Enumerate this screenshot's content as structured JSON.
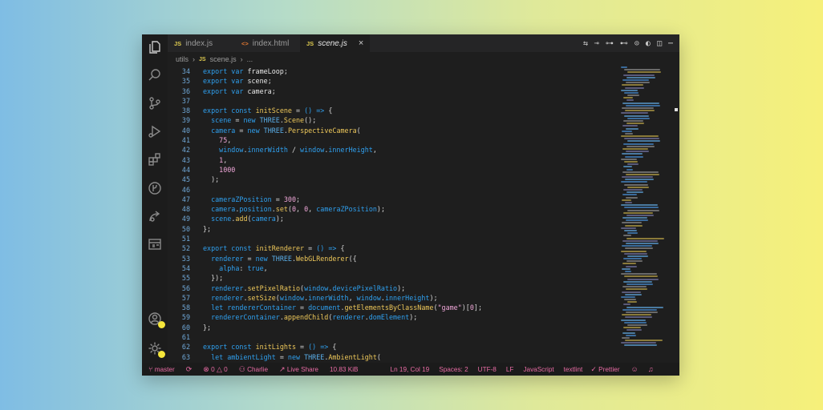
{
  "tabs": [
    {
      "label": "index.js",
      "icon": "JS"
    },
    {
      "label": "index.html",
      "icon": "<>"
    },
    {
      "label": "scene.js",
      "icon": "JS"
    }
  ],
  "tab_close": "×",
  "breadcrumb": {
    "folder": "utils",
    "file": "scene.js",
    "more": "..."
  },
  "js_icon": "JS",
  "code": [
    {
      "n": "34",
      "t": [
        [
          "kw",
          "export "
        ],
        [
          "kw",
          "var "
        ],
        [
          "id",
          "frameLoop"
        ],
        [
          "pun",
          ";"
        ]
      ]
    },
    {
      "n": "35",
      "t": [
        [
          "kw",
          "export "
        ],
        [
          "kw",
          "var "
        ],
        [
          "id",
          "scene"
        ],
        [
          "pun",
          ";"
        ]
      ]
    },
    {
      "n": "36",
      "t": [
        [
          "kw",
          "export "
        ],
        [
          "kw",
          "var "
        ],
        [
          "id",
          "camera"
        ],
        [
          "pun",
          ";"
        ]
      ]
    },
    {
      "n": "37",
      "t": []
    },
    {
      "n": "38",
      "t": [
        [
          "kw",
          "export "
        ],
        [
          "kw",
          "const "
        ],
        [
          "fn",
          "initScene"
        ],
        [
          "pun",
          " = "
        ],
        [
          "kw",
          "() => "
        ],
        [
          "pun",
          "{"
        ]
      ]
    },
    {
      "n": "39",
      "t": [
        [
          "id",
          "  "
        ],
        [
          "prm",
          "scene"
        ],
        [
          "pun",
          " = "
        ],
        [
          "kw",
          "new "
        ],
        [
          "cl",
          "THREE"
        ],
        [
          "pun",
          "."
        ],
        [
          "fn",
          "Scene"
        ],
        [
          "pun",
          "();"
        ]
      ]
    },
    {
      "n": "40",
      "t": [
        [
          "id",
          "  "
        ],
        [
          "prm",
          "camera"
        ],
        [
          "pun",
          " = "
        ],
        [
          "kw",
          "new "
        ],
        [
          "cl",
          "THREE"
        ],
        [
          "pun",
          "."
        ],
        [
          "fn",
          "PerspectiveCamera"
        ],
        [
          "pun",
          "("
        ]
      ]
    },
    {
      "n": "41",
      "t": [
        [
          "id",
          "    "
        ],
        [
          "num",
          "75"
        ],
        [
          "pun",
          ","
        ]
      ]
    },
    {
      "n": "42",
      "t": [
        [
          "id",
          "    "
        ],
        [
          "prm",
          "window"
        ],
        [
          "pun",
          "."
        ],
        [
          "prm",
          "innerWidth"
        ],
        [
          "pun",
          " / "
        ],
        [
          "prm",
          "window"
        ],
        [
          "pun",
          "."
        ],
        [
          "prm",
          "innerHeight"
        ],
        [
          "pun",
          ","
        ]
      ]
    },
    {
      "n": "43",
      "t": [
        [
          "id",
          "    "
        ],
        [
          "num",
          "1"
        ],
        [
          "pun",
          ","
        ]
      ]
    },
    {
      "n": "44",
      "t": [
        [
          "id",
          "    "
        ],
        [
          "num",
          "1000"
        ]
      ]
    },
    {
      "n": "45",
      "t": [
        [
          "pun",
          "  );"
        ]
      ]
    },
    {
      "n": "46",
      "t": []
    },
    {
      "n": "47",
      "t": [
        [
          "id",
          "  "
        ],
        [
          "prm",
          "cameraZPosition"
        ],
        [
          "pun",
          " = "
        ],
        [
          "num",
          "300"
        ],
        [
          "pun",
          ";"
        ]
      ]
    },
    {
      "n": "48",
      "t": [
        [
          "id",
          "  "
        ],
        [
          "prm",
          "camera"
        ],
        [
          "pun",
          "."
        ],
        [
          "prm",
          "position"
        ],
        [
          "pun",
          "."
        ],
        [
          "fn",
          "set"
        ],
        [
          "pun",
          "("
        ],
        [
          "num",
          "0"
        ],
        [
          "pun",
          ", "
        ],
        [
          "num",
          "0"
        ],
        [
          "pun",
          ", "
        ],
        [
          "prm",
          "cameraZPosition"
        ],
        [
          "pun",
          ");"
        ]
      ]
    },
    {
      "n": "49",
      "t": [
        [
          "id",
          "  "
        ],
        [
          "prm",
          "scene"
        ],
        [
          "pun",
          "."
        ],
        [
          "fn",
          "add"
        ],
        [
          "pun",
          "("
        ],
        [
          "prm",
          "camera"
        ],
        [
          "pun",
          ");"
        ]
      ]
    },
    {
      "n": "50",
      "t": [
        [
          "pun",
          "};"
        ]
      ]
    },
    {
      "n": "51",
      "t": []
    },
    {
      "n": "52",
      "t": [
        [
          "kw",
          "export "
        ],
        [
          "kw",
          "const "
        ],
        [
          "fn",
          "initRenderer"
        ],
        [
          "pun",
          " = "
        ],
        [
          "kw",
          "() => "
        ],
        [
          "pun",
          "{"
        ]
      ]
    },
    {
      "n": "53",
      "t": [
        [
          "id",
          "  "
        ],
        [
          "prm",
          "renderer"
        ],
        [
          "pun",
          " = "
        ],
        [
          "kw",
          "new "
        ],
        [
          "cl",
          "THREE"
        ],
        [
          "pun",
          "."
        ],
        [
          "fn",
          "WebGLRenderer"
        ],
        [
          "pun",
          "({"
        ]
      ]
    },
    {
      "n": "54",
      "t": [
        [
          "id",
          "    "
        ],
        [
          "prm",
          "alpha"
        ],
        [
          "pun",
          ": "
        ],
        [
          "kw",
          "true"
        ],
        [
          "pun",
          ","
        ]
      ]
    },
    {
      "n": "55",
      "t": [
        [
          "pun",
          "  });"
        ]
      ]
    },
    {
      "n": "56",
      "t": [
        [
          "id",
          "  "
        ],
        [
          "prm",
          "renderer"
        ],
        [
          "pun",
          "."
        ],
        [
          "fn",
          "setPixelRatio"
        ],
        [
          "pun",
          "("
        ],
        [
          "prm",
          "window"
        ],
        [
          "pun",
          "."
        ],
        [
          "prm",
          "devicePixelRatio"
        ],
        [
          "pun",
          ");"
        ]
      ]
    },
    {
      "n": "57",
      "t": [
        [
          "id",
          "  "
        ],
        [
          "prm",
          "renderer"
        ],
        [
          "pun",
          "."
        ],
        [
          "fn",
          "setSize"
        ],
        [
          "pun",
          "("
        ],
        [
          "prm",
          "window"
        ],
        [
          "pun",
          "."
        ],
        [
          "prm",
          "innerWidth"
        ],
        [
          "pun",
          ", "
        ],
        [
          "prm",
          "window"
        ],
        [
          "pun",
          "."
        ],
        [
          "prm",
          "innerHeight"
        ],
        [
          "pun",
          ");"
        ]
      ]
    },
    {
      "n": "58",
      "t": [
        [
          "id",
          "  "
        ],
        [
          "kw",
          "let "
        ],
        [
          "prm",
          "rendererContainer"
        ],
        [
          "pun",
          " = "
        ],
        [
          "prm",
          "document"
        ],
        [
          "pun",
          "."
        ],
        [
          "fn",
          "getElementsByClassName"
        ],
        [
          "pun",
          "("
        ],
        [
          "str",
          "\"game\""
        ],
        [
          "pun",
          ")["
        ],
        [
          "num",
          "0"
        ],
        [
          "pun",
          "];"
        ]
      ]
    },
    {
      "n": "59",
      "t": [
        [
          "id",
          "  "
        ],
        [
          "prm",
          "rendererContainer"
        ],
        [
          "pun",
          "."
        ],
        [
          "fn",
          "appendChild"
        ],
        [
          "pun",
          "("
        ],
        [
          "prm",
          "renderer"
        ],
        [
          "pun",
          "."
        ],
        [
          "prm",
          "domElement"
        ],
        [
          "pun",
          ");"
        ]
      ]
    },
    {
      "n": "60",
      "t": [
        [
          "pun",
          "};"
        ]
      ]
    },
    {
      "n": "61",
      "t": []
    },
    {
      "n": "62",
      "t": [
        [
          "kw",
          "export "
        ],
        [
          "kw",
          "const "
        ],
        [
          "fn",
          "initLights"
        ],
        [
          "pun",
          " = "
        ],
        [
          "kw",
          "() => "
        ],
        [
          "pun",
          "{"
        ]
      ]
    },
    {
      "n": "63",
      "t": [
        [
          "id",
          "  "
        ],
        [
          "kw",
          "let "
        ],
        [
          "prm",
          "ambientLight"
        ],
        [
          "pun",
          " = "
        ],
        [
          "kw",
          "new "
        ],
        [
          "cl",
          "THREE"
        ],
        [
          "pun",
          "."
        ],
        [
          "fn",
          "AmbientLight"
        ],
        [
          "pun",
          "("
        ]
      ]
    }
  ],
  "status": {
    "branch": "master",
    "errors": "0",
    "warnings": "0",
    "user": "Charlie",
    "live_share": "Live Share",
    "file_size": "10.83 KiB",
    "position": "Ln 19, Col 19",
    "spaces": "Spaces: 2",
    "encoding": "UTF-8",
    "eol": "LF",
    "language": "JavaScript",
    "linter": "textlint",
    "formatter": "Prettier"
  },
  "colors": {
    "status_text": "#e86ba4",
    "accent_badge": "#f5e63b",
    "keyword": "#2fa0ef",
    "function": "#eec85a",
    "number": "#f0a7d9"
  }
}
